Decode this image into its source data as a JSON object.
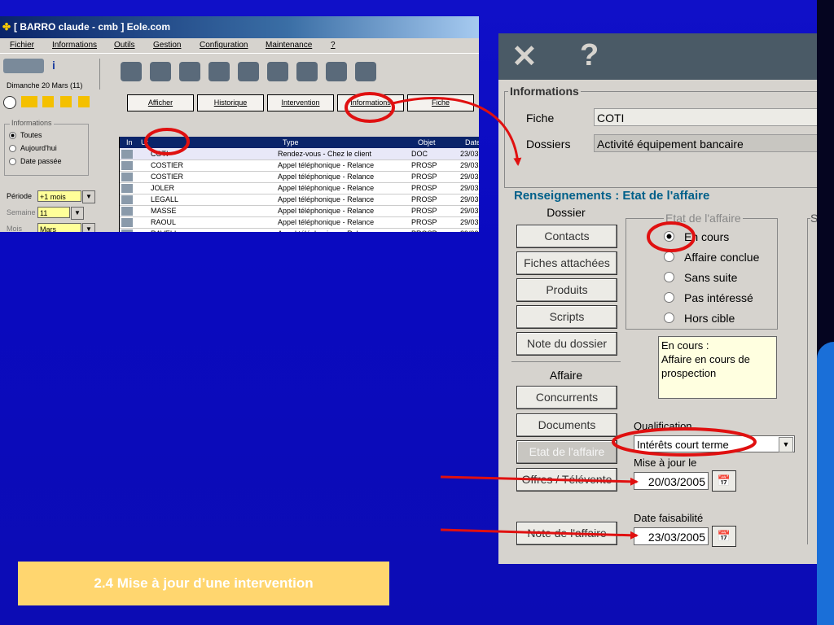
{
  "main_window": {
    "title": "[ BARRO claude - cmb ] Eole.com",
    "menu": [
      "Fichier",
      "Informations",
      "Outils",
      "Gestion",
      "Configuration",
      "Maintenance",
      "?"
    ],
    "date": "Dimanche 20 Mars (11)",
    "tabs": [
      "Afficher",
      "Historique",
      "Intervention",
      "Informations",
      "Fiche"
    ],
    "filters": {
      "legend": "Informations",
      "options": [
        "Toutes",
        "Aujourd'hui",
        "Date passée"
      ],
      "selected": "Toutes",
      "periode_label": "Période",
      "periode_value": "+1 mois",
      "semaine_label": "Semaine",
      "semaine_value": "11",
      "mois_label": "Mois",
      "mois_value": "Mars"
    },
    "grid_headers": [
      "In",
      "Ut",
      "",
      "Type",
      "Objet",
      "Date"
    ],
    "rows": [
      {
        "name": "COTI",
        "type": "Rendez-vous - Chez le client",
        "objet": "DOC",
        "date": "23/03"
      },
      {
        "name": "COSTIER",
        "type": "Appel téléphonique - Relance",
        "objet": "PROSP",
        "date": "29/03"
      },
      {
        "name": "COSTIER",
        "type": "Appel téléphonique - Relance",
        "objet": "PROSP",
        "date": "29/03"
      },
      {
        "name": "JOLER",
        "type": "Appel téléphonique - Relance",
        "objet": "PROSP",
        "date": "29/03"
      },
      {
        "name": "LEGALL",
        "type": "Appel téléphonique - Relance",
        "objet": "PROSP",
        "date": "29/03"
      },
      {
        "name": "MASSE",
        "type": "Appel téléphonique - Relance",
        "objet": "PROSP",
        "date": "29/03"
      },
      {
        "name": "RAOUL",
        "type": "Appel téléphonique - Relance",
        "objet": "PROSP",
        "date": "29/03"
      },
      {
        "name": "RAVELI",
        "type": "Appel téléphonique - Relance",
        "objet": "PROSP",
        "date": "29/03"
      }
    ]
  },
  "dialog": {
    "informations_legend": "Informations",
    "fiche_label": "Fiche",
    "fiche_value": "COTI",
    "dossiers_label": "Dossiers",
    "dossiers_value": "Activité équipement bancaire",
    "section_title": "Renseignements : Etat de l'affaire",
    "dossier_header": "Dossier",
    "dossier_buttons": [
      "Contacts",
      "Fiches attachées",
      "Produits",
      "Scripts",
      "Note du dossier"
    ],
    "affaire_header": "Affaire",
    "affaire_buttons": [
      "Concurrents",
      "Documents",
      "Etat de l'affaire",
      "Offres / Télévente",
      "Note de l'affaire"
    ],
    "etat_legend": "Etat de l'affaire",
    "etat_options": [
      "En cours",
      "Affaire conclue",
      "Sans suite",
      "Pas intéressé",
      "Hors cible"
    ],
    "etat_selected": "En cours",
    "etat_note": "En cours :\nAffaire en cours de prospection",
    "qualification_label": "Qualification",
    "qualification_value": "Intérêts court terme",
    "maj_label": "Mise à jour le",
    "maj_value": "20/03/2005",
    "faisabilite_label": "Date faisabilité",
    "faisabilite_value": "23/03/2005",
    "s_label": "S"
  },
  "caption": "2.4 Mise à jour d’une intervention",
  "colors": {
    "highlight": "#e01010",
    "caption_bg": "#ffd66f",
    "title_bar": "#0a246a",
    "section": "#00608a"
  }
}
